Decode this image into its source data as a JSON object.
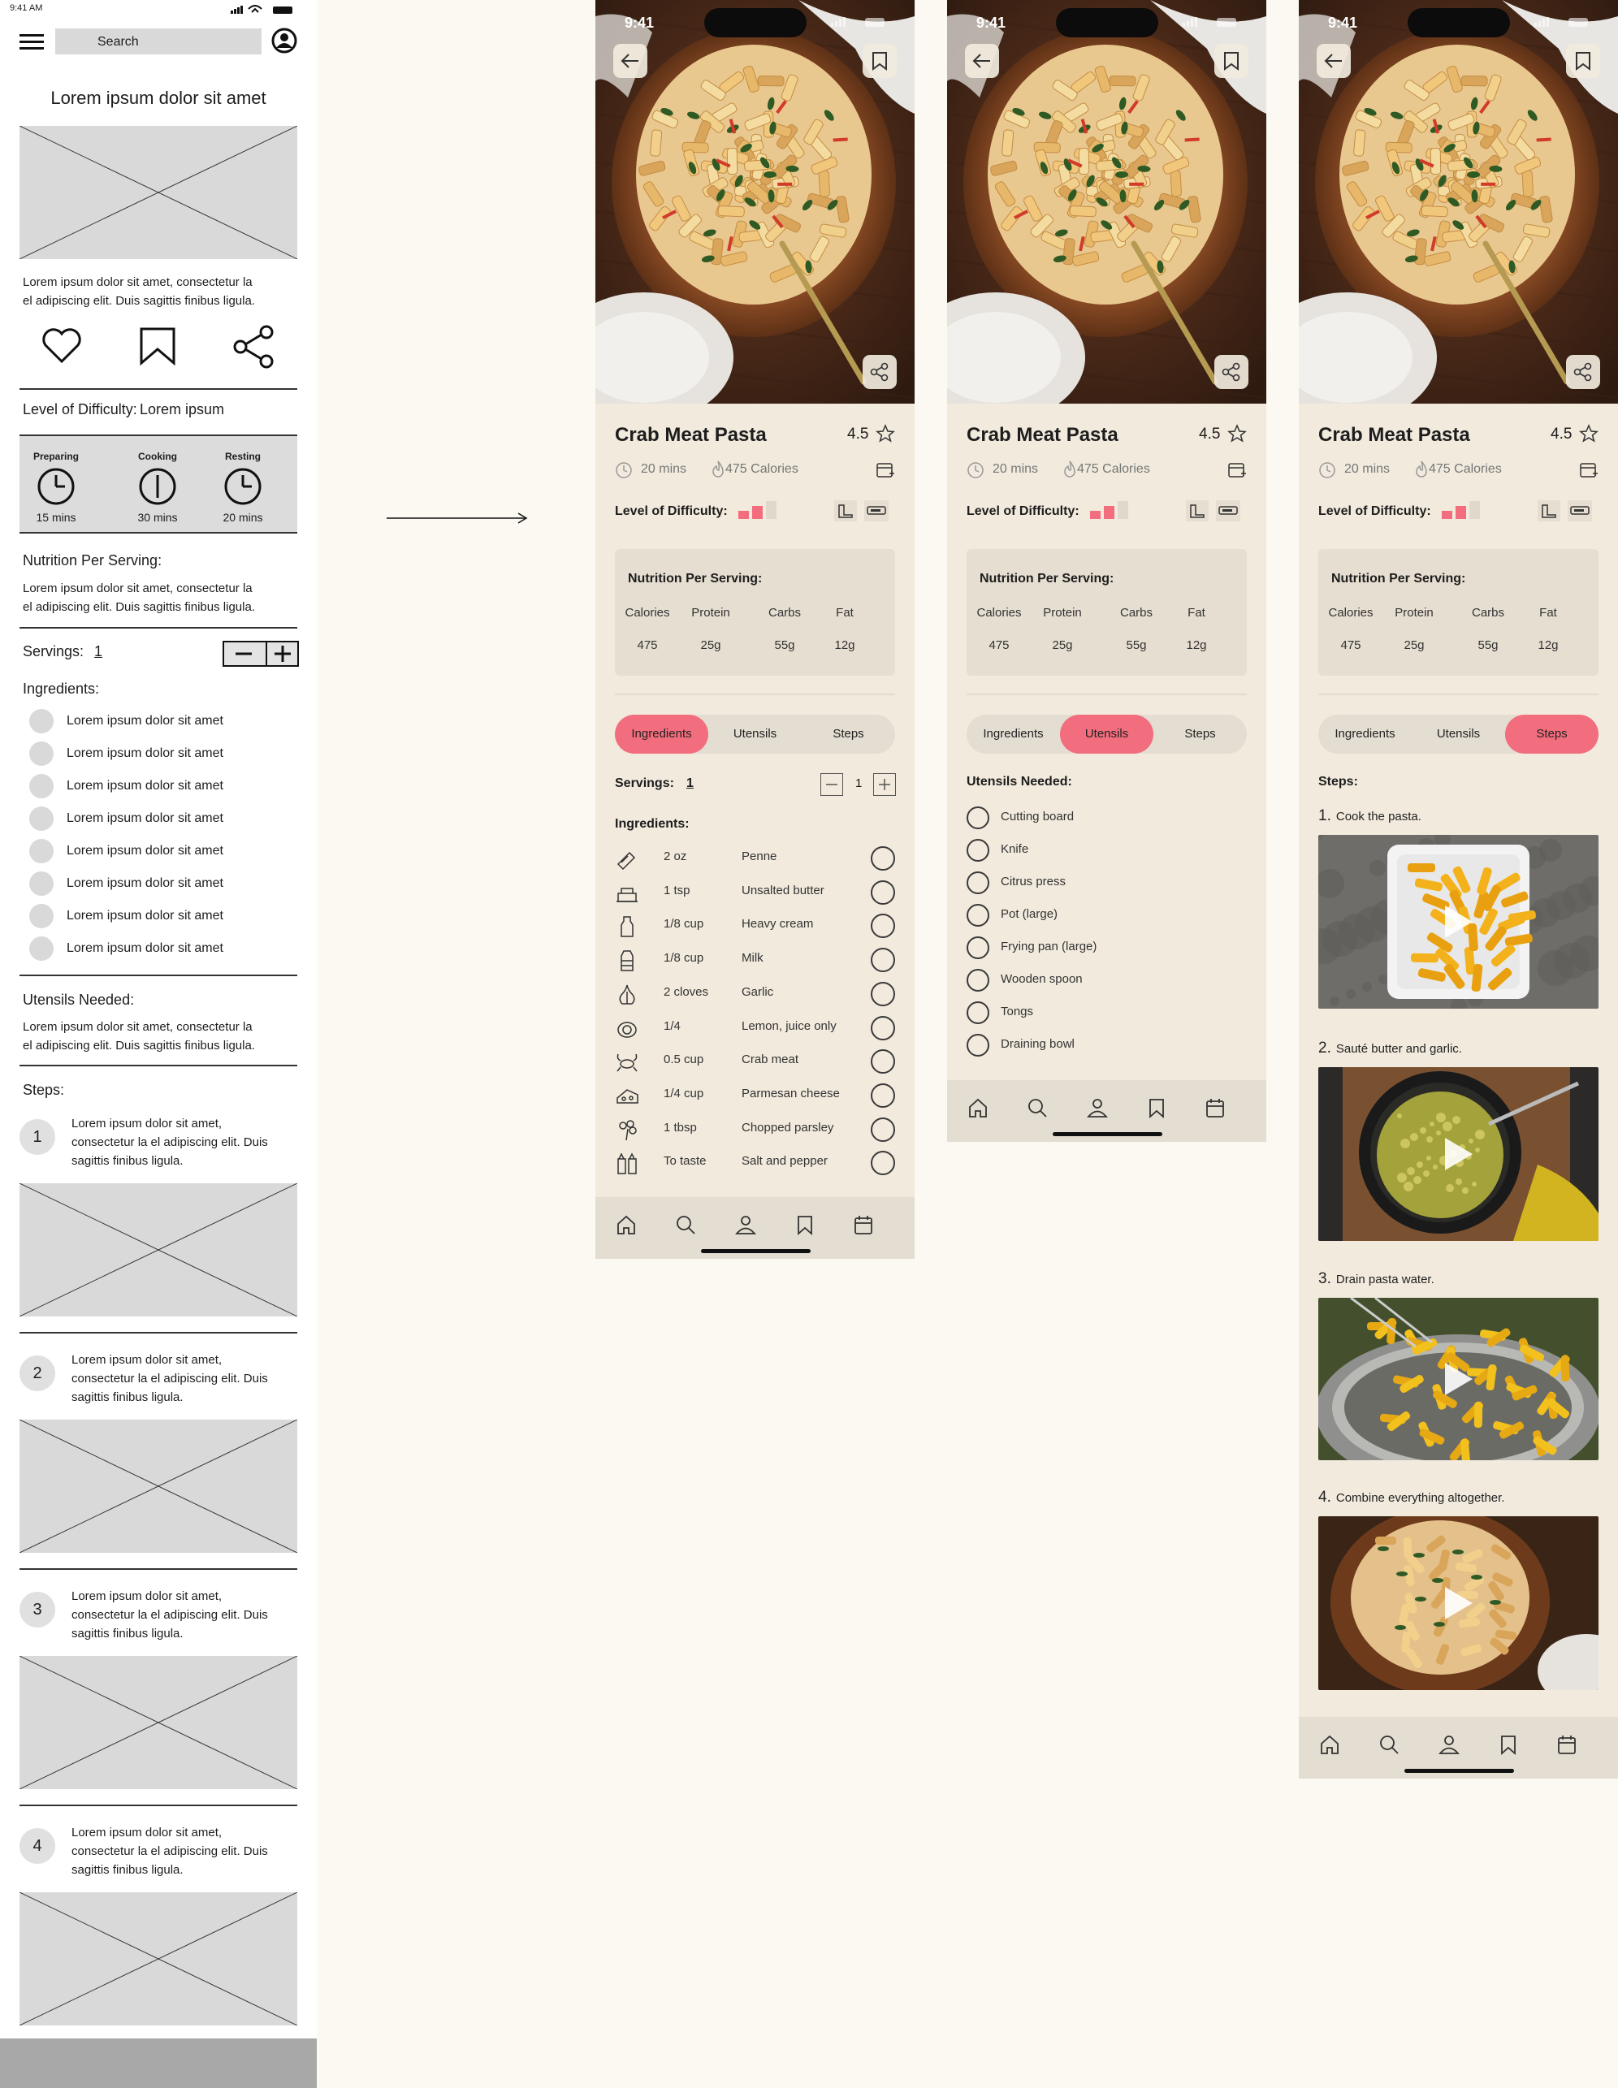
{
  "wireframe": {
    "status_time": "9:41 AM",
    "search_placeholder": "Search",
    "title": "Lorem ipsum dolor sit amet",
    "description_1": "Lorem ipsum dolor sit amet, consectetur la",
    "description_2": "el adipiscing elit. Duis sagittis finibus ligula.",
    "difficulty_label": "Level of Difficulty:",
    "difficulty_value": "Lorem ipsum",
    "times": [
      {
        "label": "Preparing",
        "value": "15 mins"
      },
      {
        "label": "Cooking",
        "value": "30 mins"
      },
      {
        "label": "Resting",
        "value": "20 mins"
      }
    ],
    "nutrition_label": "Nutrition Per Serving:",
    "nutrition_text_1": "Lorem ipsum dolor sit amet, consectetur la",
    "nutrition_text_2": "el adipiscing elit. Duis sagittis finibus ligula.",
    "servings_label": "Servings:",
    "servings_value": "1",
    "ingredients_label": "Ingredients:",
    "ingredients": [
      "Lorem ipsum dolor sit amet",
      "Lorem ipsum dolor sit amet",
      "Lorem ipsum dolor sit amet",
      "Lorem ipsum dolor sit amet",
      "Lorem ipsum dolor sit amet",
      "Lorem ipsum dolor sit amet",
      "Lorem ipsum dolor sit amet",
      "Lorem ipsum dolor sit amet"
    ],
    "utensils_label": "Utensils Needed:",
    "utensils_text_1": "Lorem ipsum dolor sit amet, consectetur la",
    "utensils_text_2": "el adipiscing elit. Duis sagittis finibus ligula.",
    "steps_label": "Steps:",
    "steps": [
      {
        "num": "1",
        "l1": "Lorem ipsum dolor sit amet,",
        "l2": "consectetur la el adipiscing elit. Duis",
        "l3": "sagittis finibus ligula."
      },
      {
        "num": "2",
        "l1": "Lorem ipsum dolor sit amet,",
        "l2": "consectetur la el adipiscing elit. Duis",
        "l3": "sagittis finibus ligula."
      },
      {
        "num": "3",
        "l1": "Lorem ipsum dolor sit amet,",
        "l2": "consectetur la el adipiscing elit. Duis",
        "l3": "sagittis finibus ligula."
      },
      {
        "num": "4",
        "l1": "Lorem ipsum dolor sit amet,",
        "l2": "consectetur la el adipiscing elit. Duis",
        "l3": "sagittis finibus ligula."
      }
    ]
  },
  "recipe": {
    "status_time": "9:41",
    "title": "Crab Meat Pasta",
    "rating": "4.5",
    "time": "20 mins",
    "calories": "475 Calories",
    "difficulty_label": "Level of Difficulty:",
    "difficulty_level": 2,
    "difficulty_max": 3,
    "nutrition_title": "Nutrition Per Serving:",
    "nutrition": [
      {
        "label": "Calories",
        "value": "475"
      },
      {
        "label": "Protein",
        "value": "25g"
      },
      {
        "label": "Carbs",
        "value": "55g"
      },
      {
        "label": "Fat",
        "value": "12g"
      }
    ],
    "tabs": [
      "Ingredients",
      "Utensils",
      "Steps"
    ],
    "servings_label": "Servings:",
    "servings_value": "1",
    "stepper_value": "1",
    "ingredients_label": "Ingredients:",
    "ingredients": [
      {
        "icon": "penne-icon",
        "qty": "2 oz",
        "name": "Penne"
      },
      {
        "icon": "butter-icon",
        "qty": "1 tsp",
        "name": "Unsalted butter"
      },
      {
        "icon": "cream-bottle-icon",
        "qty": "1/8 cup",
        "name": "Heavy cream"
      },
      {
        "icon": "milk-carton-icon",
        "qty": "1/8 cup",
        "name": "Milk"
      },
      {
        "icon": "garlic-icon",
        "qty": "2 cloves",
        "name": "Garlic"
      },
      {
        "icon": "lemon-icon",
        "qty": "1/4",
        "name": "Lemon, juice only"
      },
      {
        "icon": "crab-icon",
        "qty": "0.5 cup",
        "name": "Crab meat"
      },
      {
        "icon": "cheese-icon",
        "qty": "1/4 cup",
        "name": "Parmesan cheese"
      },
      {
        "icon": "parsley-icon",
        "qty": "1 tbsp",
        "name": "Chopped parsley"
      },
      {
        "icon": "salt-pepper-icon",
        "qty": "To taste",
        "name": "Salt and pepper"
      }
    ],
    "utensils_label": "Utensils Needed:",
    "utensils": [
      "Cutting board",
      "Knife",
      "Citrus press",
      "Pot (large)",
      "Frying pan (large)",
      "Wooden spoon",
      "Tongs",
      "Draining bowl"
    ],
    "steps_label": "Steps:",
    "steps": [
      {
        "num": "1.",
        "text": "Cook the pasta."
      },
      {
        "num": "2.",
        "text": "Sauté butter and garlic."
      },
      {
        "num": "3.",
        "text": "Drain pasta water."
      },
      {
        "num": "4.",
        "text": "Combine everything altogether."
      }
    ],
    "accent_color": "#f26d7d",
    "background_color": "#f1eadd"
  }
}
